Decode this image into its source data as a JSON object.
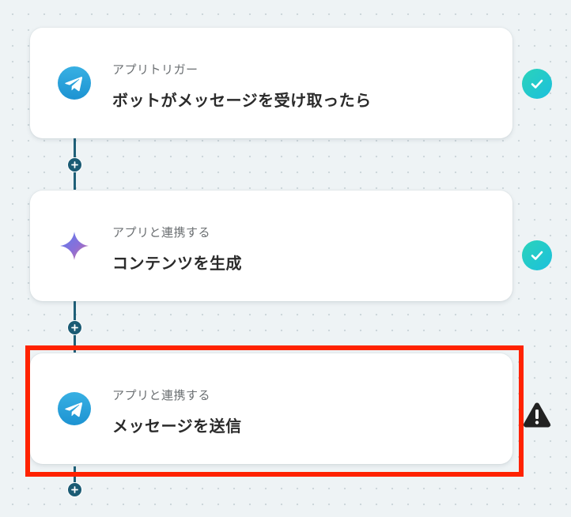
{
  "flow": {
    "steps": [
      {
        "kicker": "アプリトリガー",
        "title": "ボットがメッセージを受け取ったら",
        "icon": "telegram-icon",
        "status": "complete",
        "status_icon": "check-circle-icon"
      },
      {
        "kicker": "アプリと連携する",
        "title": "コンテンツを生成",
        "icon": "gemini-sparkle-icon",
        "status": "complete",
        "status_icon": "check-circle-icon"
      },
      {
        "kicker": "アプリと連携する",
        "title": "メッセージを送信",
        "icon": "telegram-icon",
        "status": "warning",
        "status_icon": "warning-icon",
        "highlighted": true
      }
    ],
    "add_node_icon": "plus-icon"
  },
  "colors": {
    "background": "#eef3f5",
    "connector": "#1e5f78",
    "check": "#1cc8c8",
    "warning": "#222222",
    "highlight": "#ff2200",
    "telegram": "#2aa3e0"
  }
}
